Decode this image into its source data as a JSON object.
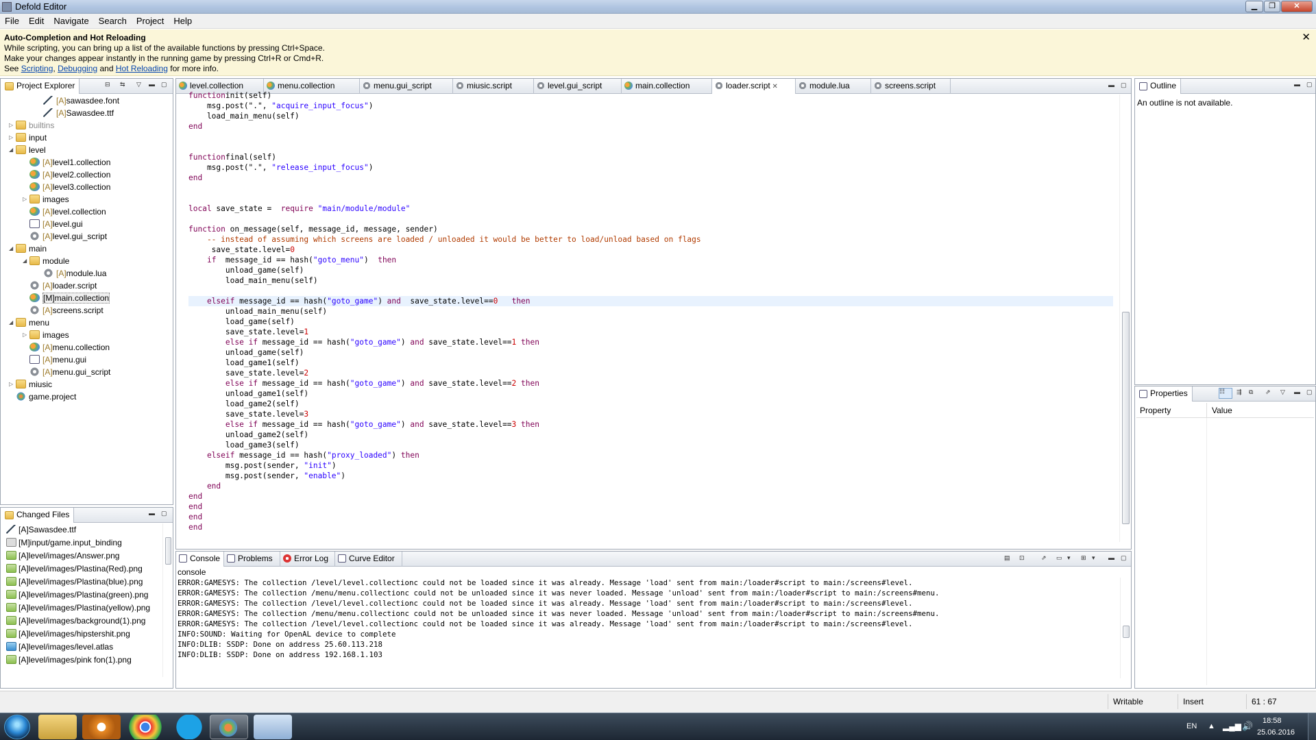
{
  "window": {
    "title": "Defold Editor"
  },
  "menu": [
    "File",
    "Edit",
    "Navigate",
    "Search",
    "Project",
    "Help"
  ],
  "notification": {
    "title": "Auto-Completion and Hot Reloading",
    "line1": "While scripting, you can bring up a list of the available functions by pressing Ctrl+Space.",
    "line2": "Make your changes appear instantly in the running game by pressing Ctrl+R or Cmd+R.",
    "see": "See",
    "link1": "Scripting",
    "comma": ",",
    "link2": "Debugging",
    "and": "and",
    "link3": "Hot Reloading",
    "tail": "for more info.",
    "close": "✕"
  },
  "project_explorer": {
    "title": "Project Explorer",
    "items": [
      {
        "depth": 2,
        "arrow": "",
        "icon": "font-icon",
        "prefix": "[A]",
        "name": "sawasdee.font"
      },
      {
        "depth": 2,
        "arrow": "",
        "icon": "font-icon",
        "prefix": "[A]",
        "name": "Sawasdee.ttf"
      },
      {
        "depth": 0,
        "arrow": "▷",
        "icon": "folder-icon",
        "prefix": "",
        "name": "builtins",
        "muted": true
      },
      {
        "depth": 0,
        "arrow": "▷",
        "icon": "folder-icon",
        "prefix": "",
        "name": "input"
      },
      {
        "depth": 0,
        "arrow": "◢",
        "icon": "folder-icon",
        "prefix": "",
        "name": "level"
      },
      {
        "depth": 1,
        "arrow": "",
        "icon": "collection-icon",
        "prefix": "[A]",
        "name": "level1.collection"
      },
      {
        "depth": 1,
        "arrow": "",
        "icon": "collection-icon",
        "prefix": "[A]",
        "name": "level2.collection"
      },
      {
        "depth": 1,
        "arrow": "",
        "icon": "collection-icon",
        "prefix": "[A]",
        "name": "level3.collection"
      },
      {
        "depth": 1,
        "arrow": "▷",
        "icon": "folder-icon",
        "prefix": "",
        "name": "images"
      },
      {
        "depth": 1,
        "arrow": "",
        "icon": "collection-icon",
        "prefix": "[A]",
        "name": "level.collection"
      },
      {
        "depth": 1,
        "arrow": "",
        "icon": "gui-icon",
        "prefix": "[A]",
        "name": "level.gui"
      },
      {
        "depth": 1,
        "arrow": "",
        "icon": "gear-icon",
        "prefix": "[A]",
        "name": "level.gui_script"
      },
      {
        "depth": 0,
        "arrow": "◢",
        "icon": "folder-icon",
        "prefix": "",
        "name": "main"
      },
      {
        "depth": 1,
        "arrow": "◢",
        "icon": "folder-icon",
        "prefix": "",
        "name": "module"
      },
      {
        "depth": 2,
        "arrow": "",
        "icon": "gear-icon",
        "prefix": "[A]",
        "name": "module.lua"
      },
      {
        "depth": 1,
        "arrow": "",
        "icon": "gear-icon",
        "prefix": "[A]",
        "name": "loader.script"
      },
      {
        "depth": 1,
        "arrow": "",
        "icon": "collection-icon",
        "prefix": "[M]",
        "name": "main.collection",
        "selected": true
      },
      {
        "depth": 1,
        "arrow": "",
        "icon": "gear-icon",
        "prefix": "[A]",
        "name": "screens.script"
      },
      {
        "depth": 0,
        "arrow": "◢",
        "icon": "folder-icon",
        "prefix": "",
        "name": "menu"
      },
      {
        "depth": 1,
        "arrow": "▷",
        "icon": "folder-icon",
        "prefix": "",
        "name": "images"
      },
      {
        "depth": 1,
        "arrow": "",
        "icon": "collection-icon",
        "prefix": "[A]",
        "name": "menu.collection"
      },
      {
        "depth": 1,
        "arrow": "",
        "icon": "gui-icon",
        "prefix": "[A]",
        "name": "menu.gui"
      },
      {
        "depth": 1,
        "arrow": "",
        "icon": "gear-icon",
        "prefix": "[A]",
        "name": "menu.gui_script"
      },
      {
        "depth": 0,
        "arrow": "▷",
        "icon": "folder-icon",
        "prefix": "",
        "name": "miusic"
      },
      {
        "depth": 0,
        "arrow": "",
        "icon": "project-icon",
        "prefix": "",
        "name": "game.project"
      }
    ]
  },
  "changed_files": {
    "title": "Changed Files",
    "items": [
      {
        "icon": "font-icon",
        "text": "[A]Sawasdee.ttf"
      },
      {
        "icon": "binding-icon",
        "text": "[M]input/game.input_binding"
      },
      {
        "icon": "image-icon",
        "text": "[A]level/images/Answer.png"
      },
      {
        "icon": "image-icon",
        "text": "[A]level/images/Plastina(Red).png"
      },
      {
        "icon": "image-icon",
        "text": "[A]level/images/Plastina(blue).png"
      },
      {
        "icon": "image-icon",
        "text": "[A]level/images/Plastina(green).png"
      },
      {
        "icon": "image-icon",
        "text": "[A]level/images/Plastina(yellow).png"
      },
      {
        "icon": "image-icon",
        "text": "[A]level/images/background(1).png"
      },
      {
        "icon": "image-icon",
        "text": "[A]level/images/hipstershit.png"
      },
      {
        "icon": "atlas-icon",
        "text": "[A]level/images/level.atlas"
      },
      {
        "icon": "image-icon",
        "text": "[A]level/images/pink fon(1).png"
      }
    ]
  },
  "editor_tabs": [
    {
      "label": "level.collection",
      "icon": "collection-icon"
    },
    {
      "label": "menu.collection",
      "icon": "collection-icon"
    },
    {
      "label": "menu.gui_script",
      "icon": "gear-icon"
    },
    {
      "label": "miusic.script",
      "icon": "gear-icon"
    },
    {
      "label": "level.gui_script",
      "icon": "gear-icon"
    },
    {
      "label": "main.collection",
      "icon": "collection-icon"
    },
    {
      "label": "loader.script",
      "icon": "gear-icon",
      "active": true
    },
    {
      "label": "module.lua",
      "icon": "gear-icon"
    },
    {
      "label": "screens.script",
      "icon": "gear-icon"
    }
  ],
  "code_lines": [
    [
      [
        "kw",
        "function"
      ],
      [
        "",
        "init(self)"
      ]
    ],
    [
      [
        "",
        "    msg.post(\".\", "
      ],
      [
        "str",
        "\"acquire_input_focus\""
      ],
      [
        "",
        ")"
      ]
    ],
    [
      [
        "",
        "    load_main_menu(self)"
      ]
    ],
    [
      [
        "kw",
        "end"
      ]
    ],
    [],
    [],
    [
      [
        "kw",
        "function"
      ],
      [
        "",
        ""
      ],
      [
        "",
        "final(self)"
      ]
    ],
    [
      [
        "",
        "    msg.post(\".\", "
      ],
      [
        "str",
        "\"release_input_focus\""
      ],
      [
        "",
        ")"
      ]
    ],
    [
      [
        "kw",
        "end"
      ]
    ],
    [],
    [],
    [
      [
        "kw",
        "local"
      ],
      [
        "",
        " save_state =  "
      ],
      [
        "kw",
        "require"
      ],
      [
        "",
        " "
      ],
      [
        "str",
        "\"main/module/module\""
      ]
    ],
    [],
    [
      [
        "kw",
        "function"
      ],
      [
        "",
        " on_message(self, message_id, message, sender)"
      ]
    ],
    [
      [
        "cmt",
        "    -- instead of assuming which screens are loaded / unloaded it would be better to load/unload based on flags"
      ]
    ],
    [
      [
        "",
        "     save_state.level="
      ],
      [
        "num",
        "0"
      ]
    ],
    [
      [
        "",
        "    "
      ],
      [
        "kw",
        "if"
      ],
      [
        "",
        "  message_id == hash("
      ],
      [
        "str",
        "\"goto_menu\""
      ],
      [
        "",
        ")  "
      ],
      [
        "kw",
        "then"
      ]
    ],
    [
      [
        "",
        "        unload_game(self)"
      ]
    ],
    [
      [
        "",
        "        load_main_menu(self)"
      ]
    ],
    [],
    [
      [
        "",
        "    "
      ],
      [
        "kw",
        "elseif"
      ],
      [
        "",
        " message_id == hash("
      ],
      [
        "str",
        "\"goto_game\""
      ],
      [
        "",
        ") "
      ],
      [
        "kw",
        "and"
      ],
      [
        "",
        "  save_state.level=="
      ],
      [
        "num",
        "0"
      ],
      [
        "",
        "   "
      ],
      [
        "kw",
        "then"
      ]
    ],
    [
      [
        "",
        "        unload_main_menu(self)"
      ]
    ],
    [
      [
        "",
        "        load_game(self)"
      ]
    ],
    [
      [
        "",
        "        save_state.level="
      ],
      [
        "num",
        "1"
      ]
    ],
    [
      [
        "",
        "        "
      ],
      [
        "kw",
        "else if"
      ],
      [
        "",
        " message_id == hash("
      ],
      [
        "str",
        "\"goto_game\""
      ],
      [
        "",
        ") "
      ],
      [
        "kw",
        "and"
      ],
      [
        "",
        " save_state.level=="
      ],
      [
        "num",
        "1"
      ],
      [
        "",
        " "
      ],
      [
        "kw",
        "then"
      ]
    ],
    [
      [
        "",
        "        unload_game(self)"
      ]
    ],
    [
      [
        "",
        "        load_game1(self)"
      ]
    ],
    [
      [
        "",
        "        save_state.level="
      ],
      [
        "num",
        "2"
      ]
    ],
    [
      [
        "",
        "        "
      ],
      [
        "kw",
        "else if"
      ],
      [
        "",
        " message_id == hash("
      ],
      [
        "str",
        "\"goto_game\""
      ],
      [
        "",
        ") "
      ],
      [
        "kw",
        "and"
      ],
      [
        "",
        " save_state.level=="
      ],
      [
        "num",
        "2"
      ],
      [
        "",
        " "
      ],
      [
        "kw",
        "then"
      ]
    ],
    [
      [
        "",
        "        unload_game1(self)"
      ]
    ],
    [
      [
        "",
        "        load_game2(self)"
      ]
    ],
    [
      [
        "",
        "        save_state.level="
      ],
      [
        "num",
        "3"
      ]
    ],
    [
      [
        "",
        "        "
      ],
      [
        "kw",
        "else if"
      ],
      [
        "",
        " message_id == hash("
      ],
      [
        "str",
        "\"goto_game\""
      ],
      [
        "",
        ") "
      ],
      [
        "kw",
        "and"
      ],
      [
        "",
        " save_state.level=="
      ],
      [
        "num",
        "3"
      ],
      [
        "",
        " "
      ],
      [
        "kw",
        "then"
      ]
    ],
    [
      [
        "",
        "        unload_game2(self)"
      ]
    ],
    [
      [
        "",
        "        load_game3(self)"
      ]
    ],
    [
      [
        "",
        "    "
      ],
      [
        "kw",
        "elseif"
      ],
      [
        "",
        " message_id == hash("
      ],
      [
        "str",
        "\"proxy_loaded\""
      ],
      [
        "",
        ") "
      ],
      [
        "kw",
        "then"
      ]
    ],
    [
      [
        "",
        "        msg.post(sender, "
      ],
      [
        "str",
        "\"init\""
      ],
      [
        "",
        ")"
      ]
    ],
    [
      [
        "",
        "        msg.post(sender, "
      ],
      [
        "str",
        "\"enable\""
      ],
      [
        "",
        ")"
      ]
    ],
    [
      [
        "kw",
        "    end"
      ]
    ],
    [
      [
        "kw",
        "end"
      ]
    ],
    [
      [
        "kw",
        "end"
      ]
    ],
    [
      [
        "kw",
        "end"
      ]
    ],
    [
      [
        "kw",
        "end"
      ]
    ]
  ],
  "outline": {
    "title": "Outline",
    "empty": "An outline is not available."
  },
  "properties": {
    "title": "Properties",
    "col_property": "Property",
    "col_value": "Value"
  },
  "bottom_tabs": [
    {
      "label": "Console",
      "active": true
    },
    {
      "label": "Problems"
    },
    {
      "label": "Error Log"
    },
    {
      "label": "Curve Editor"
    }
  ],
  "console": {
    "name": "console",
    "lines": [
      "ERROR:GAMESYS: The collection /level/level.collectionc could not be loaded since it was already. Message 'load' sent from main:/loader#script to main:/screens#level.",
      "ERROR:GAMESYS: The collection /menu/menu.collectionc could not be unloaded since it was never loaded. Message 'unload' sent from main:/loader#script to main:/screens#menu.",
      "ERROR:GAMESYS: The collection /level/level.collectionc could not be loaded since it was already. Message 'load' sent from main:/loader#script to main:/screens#level.",
      "ERROR:GAMESYS: The collection /menu/menu.collectionc could not be unloaded since it was never loaded. Message 'unload' sent from main:/loader#script to main:/screens#menu.",
      "ERROR:GAMESYS: The collection /level/level.collectionc could not be loaded since it was already. Message 'load' sent from main:/loader#script to main:/screens#level.",
      "INFO:SOUND: Waiting for OpenAL device to complete",
      "INFO:DLIB: SSDP: Done on address 25.60.113.218",
      "INFO:DLIB: SSDP: Done on address 192.168.1.103"
    ]
  },
  "status": {
    "writable": "Writable",
    "insert": "Insert",
    "position": "61 : 67"
  },
  "taskbar": {
    "lang": "EN",
    "time": "18:58",
    "date": "25.06.2016"
  },
  "colors": {
    "keyword": "#7f0055",
    "string": "#2a00ff",
    "number": "#cc0000",
    "comment": "#b03b00",
    "current_line": "#e8f2fe",
    "notify_bg": "#fbf6d9"
  }
}
